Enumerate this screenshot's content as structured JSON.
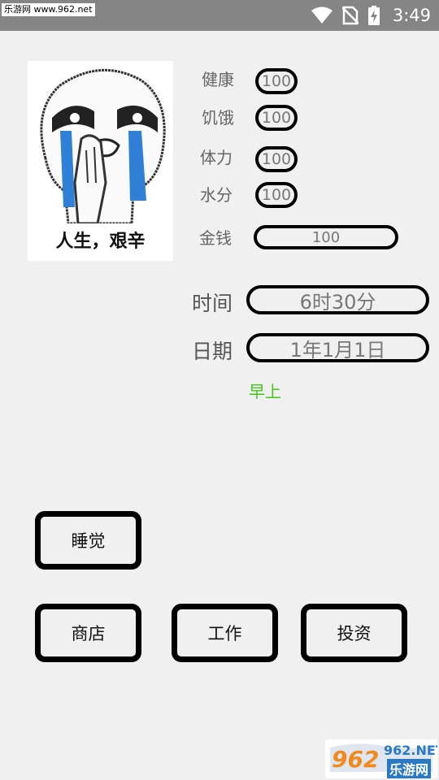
{
  "status_bar": {
    "watermark": "乐游网 www.962.net",
    "time": "3:49",
    "icons": [
      "wifi-icon",
      "no-sim-icon",
      "battery-charging-icon"
    ]
  },
  "avatar": {
    "image": "crying-meme-face",
    "caption": "人生，艰辛"
  },
  "stats": {
    "health": {
      "label": "健康",
      "value": "100"
    },
    "hunger": {
      "label": "饥饿",
      "value": "100"
    },
    "stamina": {
      "label": "体力",
      "value": "100"
    },
    "water": {
      "label": "水分",
      "value": "100"
    },
    "money": {
      "label": "金钱",
      "value": "100"
    }
  },
  "time_info": {
    "time_label": "时间",
    "time_value": "6时30分",
    "date_label": "日期",
    "date_value": "1年1月1日",
    "period": "早上"
  },
  "actions": {
    "sleep": "睡觉",
    "shop": "商店",
    "work": "工作",
    "invest": "投资"
  },
  "footer_watermark": {
    "logo": "962.NET",
    "site": "乐游网"
  },
  "colors": {
    "background": "#f0f0f0",
    "status_bar": "#858585",
    "period_text": "#44c51a",
    "border": "#000000"
  }
}
